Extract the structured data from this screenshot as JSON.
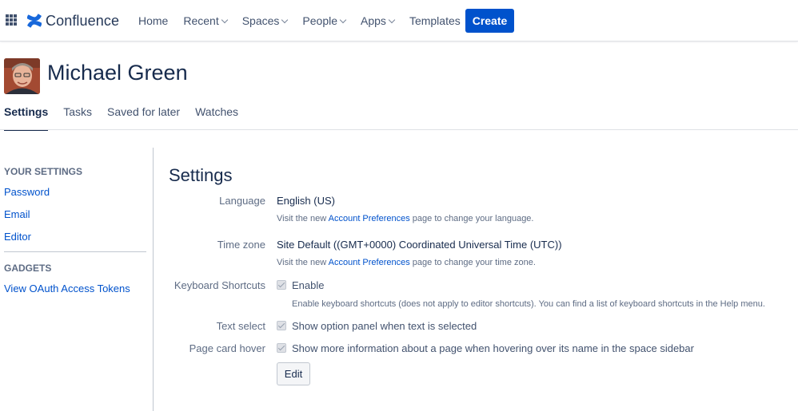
{
  "brand": {
    "name": "Confluence",
    "color": "#0052cc"
  },
  "nav": {
    "items": [
      {
        "label": "Home",
        "dropdown": false
      },
      {
        "label": "Recent",
        "dropdown": true
      },
      {
        "label": "Spaces",
        "dropdown": true
      },
      {
        "label": "People",
        "dropdown": true
      },
      {
        "label": "Apps",
        "dropdown": true
      },
      {
        "label": "Templates",
        "dropdown": false
      }
    ],
    "create_label": "Create"
  },
  "profile": {
    "name": "Michael Green"
  },
  "tabs": [
    {
      "label": "Settings",
      "active": true
    },
    {
      "label": "Tasks",
      "active": false
    },
    {
      "label": "Saved for later",
      "active": false
    },
    {
      "label": "Watches",
      "active": false
    }
  ],
  "sidebar": {
    "your_settings_heading": "YOUR SETTINGS",
    "your_settings_links": [
      "Password",
      "Email",
      "Editor"
    ],
    "gadgets_heading": "GADGETS",
    "gadgets_links": [
      "View OAuth Access Tokens"
    ]
  },
  "settings": {
    "title": "Settings",
    "language": {
      "label": "Language",
      "value": "English (US)",
      "help_prefix": "Visit the new ",
      "help_link": "Account Preferences",
      "help_suffix": " page to change your language."
    },
    "timezone": {
      "label": "Time zone",
      "value": "Site Default ((GMT+0000) Coordinated Universal Time (UTC))",
      "help_prefix": "Visit the new ",
      "help_link": "Account Preferences",
      "help_suffix": " page to change your time zone."
    },
    "keyboard": {
      "label": "Keyboard Shortcuts",
      "checkbox_label": "Enable",
      "checked": true,
      "help": "Enable keyboard shortcuts (does not apply to editor shortcuts). You can find a list of keyboard shortcuts in the Help menu."
    },
    "text_select": {
      "label": "Text select",
      "checkbox_label": "Show option panel when text is selected",
      "checked": true
    },
    "page_card": {
      "label": "Page card hover",
      "checkbox_label": "Show more information about a page when hovering over its name in the space sidebar",
      "checked": true
    },
    "edit_label": "Edit"
  }
}
